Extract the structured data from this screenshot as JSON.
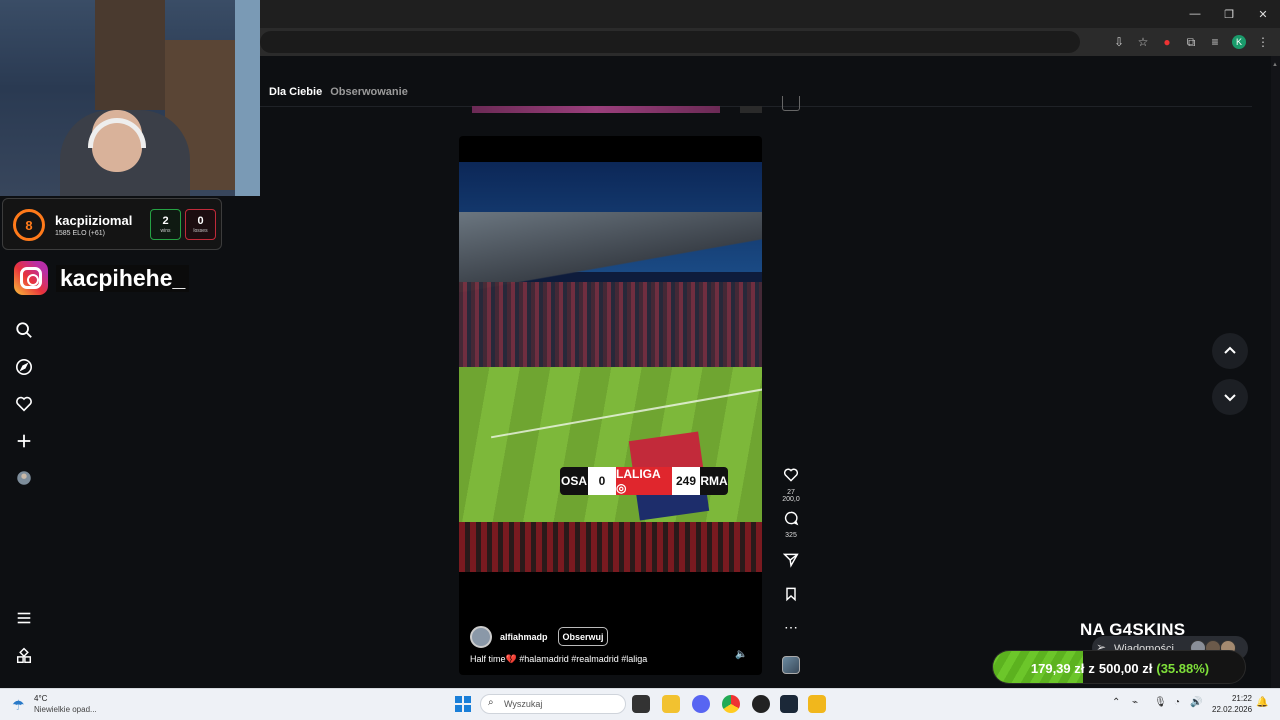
{
  "window": {
    "minimize": "—",
    "maximize": "❐",
    "close": "✕"
  },
  "nav": {
    "tab_for_you": "Dla Ciebie",
    "tab_following": "Obserwowanie"
  },
  "elo_card": {
    "level": "8",
    "username": "kacpiiziomal",
    "elo": "1585 ELO (+61)",
    "wins": "2",
    "wins_label": "wins",
    "losses": "0",
    "losses_label": "losses"
  },
  "instagram": {
    "handle": "kacpihehe_"
  },
  "video": {
    "username": "alfiahmadp",
    "follow_label": "Obserwuj",
    "caption": "Half time💔 #halamadrid #realmadrid #laliga",
    "scorebug": {
      "home": "OSA",
      "home_score": "0",
      "league": "LALIGA ◎",
      "away_score": "249",
      "away": "RMA"
    }
  },
  "actions": {
    "likes": "27 200,0",
    "comments": "325"
  },
  "overlay": {
    "title": "NA G4SKINS",
    "messages_label": "Wiadomości",
    "current": "179,39 zł",
    "sep": "z",
    "goal": "500,00 zł",
    "percent": "(35.88%)",
    "progress_fraction": 0.3588
  },
  "taskbar": {
    "temp": "4°C",
    "weather": "Niewielkie opad...",
    "search_placeholder": "Wyszukaj",
    "time": "21:22",
    "date": "22.02.2026"
  }
}
